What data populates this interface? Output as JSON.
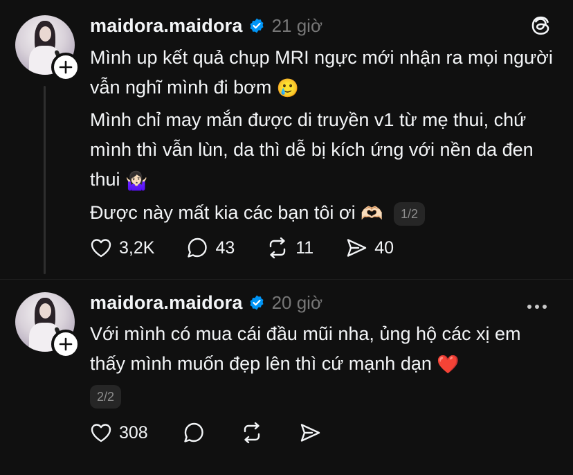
{
  "posts": [
    {
      "username": "maidora.maidora",
      "time": "21 giờ",
      "paragraphs": [
        "Mình up kết quả chụp MRI ngực mới nhận ra mọi người vẫn nghĩ mình đi bơm",
        "Mình chỉ may mắn được di truyền v1 từ mẹ thui, chứ mình thì vẫn lùn, da thì dễ bị kích ứng với nền da đen thui",
        "Được này mất kia các bạn tôi ơi"
      ],
      "emojis": [
        "🥲",
        "🤷🏻‍♀️",
        "🫶🏻"
      ],
      "page": "1/2",
      "likes": "3,2K",
      "replies": "43",
      "reposts": "11",
      "shares": "40"
    },
    {
      "username": "maidora.maidora",
      "time": "20 giờ",
      "paragraphs": [
        "Với mình có mua cái đầu mũi nha, ủng hộ các xị em thấy mình muốn đẹp lên thì cứ mạnh dạn"
      ],
      "emojis": [
        "❤️"
      ],
      "page": "2/2",
      "likes": "308"
    }
  ],
  "colors": {
    "background": "#101010",
    "text": "#f3f5f7",
    "muted": "#777777",
    "verified": "#0095f6"
  }
}
